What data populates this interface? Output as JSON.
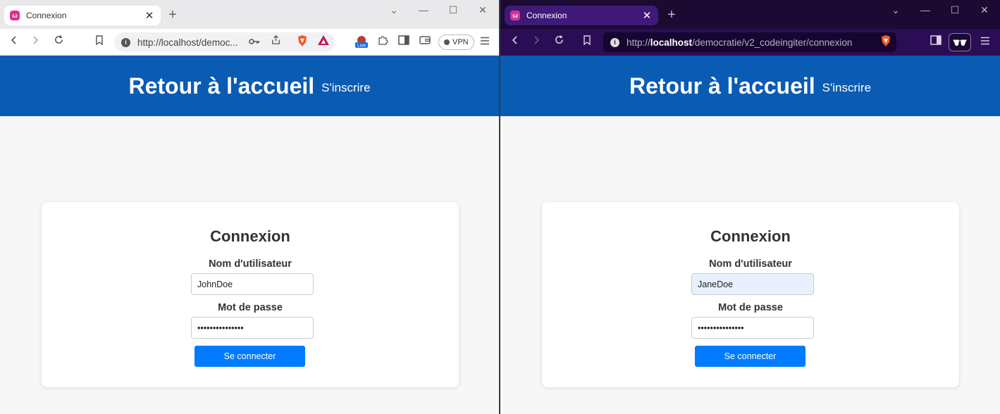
{
  "windows": [
    {
      "theme": "light",
      "tab_title": "Connexion",
      "url_display": "http://localhost/democ...",
      "vpn_label": "VPN",
      "header": {
        "home_link": "Retour à l'accueil",
        "signup_link": "S'inscrire"
      },
      "form": {
        "title": "Connexion",
        "username_label": "Nom d'utilisateur",
        "username_value": "JohnDoe",
        "password_label": "Mot de passe",
        "password_value": "•••••••••••••••",
        "submit_label": "Se connecter"
      }
    },
    {
      "theme": "dark",
      "tab_title": "Connexion",
      "url_scheme": "http://",
      "url_host": "localhost",
      "url_path": "/democratie/v2_codeingiter/connexion",
      "header": {
        "home_link": "Retour à l'accueil",
        "signup_link": "S'inscrire"
      },
      "form": {
        "title": "Connexion",
        "username_label": "Nom d'utilisateur",
        "username_value": "JaneDoe",
        "password_label": "Mot de passe",
        "password_value": "•••••••••••••••",
        "submit_label": "Se connecter"
      }
    }
  ],
  "colors": {
    "header_bg": "#0a5bb4",
    "button_bg": "#007bff",
    "dark_tab_bg": "#3f1a78",
    "dark_toolbar_bg": "#2b0d55",
    "autofill_bg": "#e8f0fe"
  },
  "icons": {
    "back": "chevron-left-icon",
    "forward": "chevron-right-icon",
    "reload": "reload-icon",
    "bookmark": "bookmark-icon",
    "key": "key-icon",
    "share": "share-icon",
    "brave": "brave-shield-icon",
    "rewards": "brave-rewards-icon",
    "extensions": "puzzle-icon",
    "sidebar": "sidebar-icon",
    "wallet": "wallet-icon",
    "menu": "hamburger-menu-icon"
  }
}
